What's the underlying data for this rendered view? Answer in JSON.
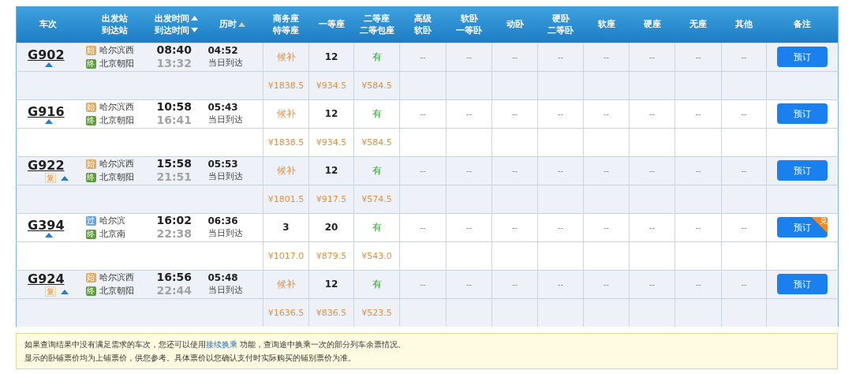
{
  "table": {
    "columns": [
      {
        "lines": [
          "车次"
        ]
      },
      {
        "lines": [
          "出发站",
          "到达站"
        ]
      },
      {
        "lines": [
          "出发时间",
          "到达时间"
        ],
        "kind": "sort_pair",
        "sort_active": true
      },
      {
        "lines": [
          "历时"
        ],
        "kind": "sort_single",
        "sort_active": false
      },
      {
        "lines": [
          "商务座",
          "特等座"
        ]
      },
      {
        "lines": [
          "一等座"
        ]
      },
      {
        "lines": [
          "二等座",
          "二等包座"
        ]
      },
      {
        "lines": [
          "高级",
          "软卧"
        ]
      },
      {
        "lines": [
          "软卧",
          "一等卧"
        ]
      },
      {
        "lines": [
          "动卧"
        ]
      },
      {
        "lines": [
          "硬卧",
          "二等卧"
        ]
      },
      {
        "lines": [
          "软座"
        ]
      },
      {
        "lines": [
          "硬座"
        ]
      },
      {
        "lines": [
          "无座"
        ]
      },
      {
        "lines": [
          "其他"
        ]
      },
      {
        "lines": [
          "备注"
        ]
      }
    ],
    "trains": [
      {
        "number": "G902",
        "from": {
          "kind": "start",
          "badge": "始",
          "name": "哈尔滨西"
        },
        "to": {
          "kind": "end",
          "badge": "终",
          "name": "北京朝阳"
        },
        "depart": "08:40",
        "arrive": "13:32",
        "duration": "04:52",
        "arrival_note": "当日到达",
        "seats": [
          {
            "kind": "waitlist",
            "text": "候补"
          },
          {
            "kind": "count",
            "text": "12"
          },
          {
            "kind": "available",
            "text": "有"
          },
          {
            "kind": "none",
            "text": "--"
          },
          {
            "kind": "none",
            "text": "--"
          },
          {
            "kind": "none",
            "text": "--"
          },
          {
            "kind": "none",
            "text": "--"
          },
          {
            "kind": "none",
            "text": "--"
          },
          {
            "kind": "none",
            "text": "--"
          },
          {
            "kind": "none",
            "text": "--"
          },
          {
            "kind": "none",
            "text": "--"
          }
        ],
        "prices": [
          "¥1838.5",
          "¥934.5",
          "¥584.5"
        ],
        "book_button": {
          "label": "预订"
        }
      },
      {
        "number": "G916",
        "from": {
          "kind": "start",
          "badge": "始",
          "name": "哈尔滨西"
        },
        "to": {
          "kind": "end",
          "badge": "终",
          "name": "北京朝阳"
        },
        "depart": "10:58",
        "arrive": "16:41",
        "duration": "05:43",
        "arrival_note": "当日到达",
        "seats": [
          {
            "kind": "waitlist",
            "text": "候补"
          },
          {
            "kind": "count",
            "text": "12"
          },
          {
            "kind": "available",
            "text": "有"
          },
          {
            "kind": "none",
            "text": "--"
          },
          {
            "kind": "none",
            "text": "--"
          },
          {
            "kind": "none",
            "text": "--"
          },
          {
            "kind": "none",
            "text": "--"
          },
          {
            "kind": "none",
            "text": "--"
          },
          {
            "kind": "none",
            "text": "--"
          },
          {
            "kind": "none",
            "text": "--"
          },
          {
            "kind": "none",
            "text": "--"
          }
        ],
        "prices": [
          "¥1838.5",
          "¥934.5",
          "¥584.5"
        ],
        "book_button": {
          "label": "预订"
        }
      },
      {
        "number": "G922",
        "rebook_tag": "复",
        "from": {
          "kind": "start",
          "badge": "始",
          "name": "哈尔滨西"
        },
        "to": {
          "kind": "end",
          "badge": "终",
          "name": "北京朝阳"
        },
        "depart": "15:58",
        "arrive": "21:51",
        "duration": "05:53",
        "arrival_note": "当日到达",
        "seats": [
          {
            "kind": "waitlist",
            "text": "候补"
          },
          {
            "kind": "count",
            "text": "12"
          },
          {
            "kind": "available",
            "text": "有"
          },
          {
            "kind": "none",
            "text": "--"
          },
          {
            "kind": "none",
            "text": "--"
          },
          {
            "kind": "none",
            "text": "--"
          },
          {
            "kind": "none",
            "text": "--"
          },
          {
            "kind": "none",
            "text": "--"
          },
          {
            "kind": "none",
            "text": "--"
          },
          {
            "kind": "none",
            "text": "--"
          },
          {
            "kind": "none",
            "text": "--"
          }
        ],
        "prices": [
          "¥1801.5",
          "¥917.5",
          "¥574.5"
        ],
        "book_button": {
          "label": "预订"
        }
      },
      {
        "number": "G394",
        "from": {
          "kind": "pass",
          "badge": "过",
          "name": "哈尔滨"
        },
        "to": {
          "kind": "end",
          "badge": "终",
          "name": "北京南"
        },
        "depart": "16:02",
        "arrive": "22:38",
        "duration": "06:36",
        "arrival_note": "当日到达",
        "seats": [
          {
            "kind": "count",
            "text": "3"
          },
          {
            "kind": "count",
            "text": "20"
          },
          {
            "kind": "available",
            "text": "有"
          },
          {
            "kind": "none",
            "text": "--"
          },
          {
            "kind": "none",
            "text": "--"
          },
          {
            "kind": "none",
            "text": "--"
          },
          {
            "kind": "none",
            "text": "--"
          },
          {
            "kind": "none",
            "text": "--"
          },
          {
            "kind": "none",
            "text": "--"
          },
          {
            "kind": "none",
            "text": "--"
          },
          {
            "kind": "none",
            "text": "--"
          }
        ],
        "prices": [
          "¥1017.0",
          "¥879.5",
          "¥543.0"
        ],
        "book_button": {
          "label": "预订",
          "corner_tag": "兑"
        }
      },
      {
        "number": "G924",
        "rebook_tag": "复",
        "from": {
          "kind": "start",
          "badge": "始",
          "name": "哈尔滨西"
        },
        "to": {
          "kind": "end",
          "badge": "终",
          "name": "北京朝阳"
        },
        "depart": "16:56",
        "arrive": "22:44",
        "duration": "05:48",
        "arrival_note": "当日到达",
        "seats": [
          {
            "kind": "waitlist",
            "text": "候补"
          },
          {
            "kind": "count",
            "text": "12"
          },
          {
            "kind": "available",
            "text": "有"
          },
          {
            "kind": "none",
            "text": "--"
          },
          {
            "kind": "none",
            "text": "--"
          },
          {
            "kind": "none",
            "text": "--"
          },
          {
            "kind": "none",
            "text": "--"
          },
          {
            "kind": "none",
            "text": "--"
          },
          {
            "kind": "none",
            "text": "--"
          },
          {
            "kind": "none",
            "text": "--"
          },
          {
            "kind": "none",
            "text": "--"
          }
        ],
        "prices": [
          "¥1636.5",
          "¥836.5",
          "¥523.5"
        ],
        "book_button": {
          "label": "预订"
        }
      }
    ]
  },
  "notice": {
    "line_1": {
      "before": "如果查询结果中没有满足需求的车次，您还可以使用",
      "link": "接续换乘",
      "after": " 功能，查询途中换乘一次的部分列车余票情况。"
    },
    "line_2": "显示的卧铺票价均为上铺票价，供您参考。具体票价以您确认支付时实际购买的铺别票价为准。"
  }
}
